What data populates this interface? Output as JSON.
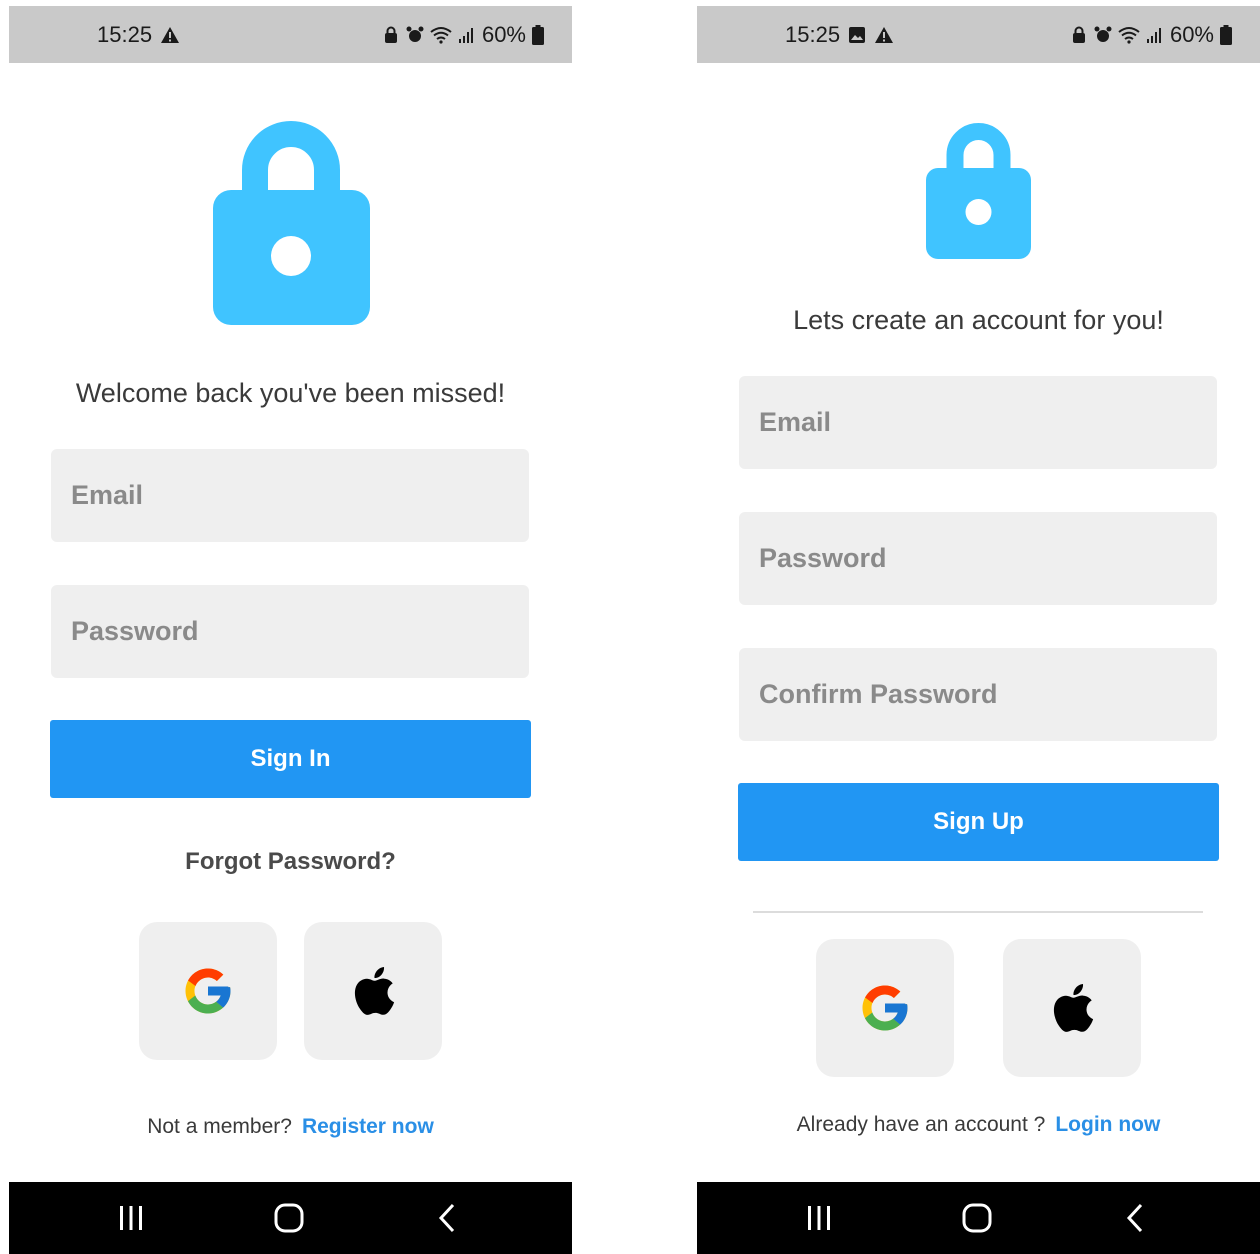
{
  "status_bar": {
    "time": "15:25",
    "battery": "60%"
  },
  "login_screen": {
    "welcome_text": "Welcome back you've been missed!",
    "email_placeholder": "Email",
    "password_placeholder": "Password",
    "sign_in_label": "Sign In",
    "forgot_password_label": "Forgot Password?",
    "footer_prompt": "Not a member?",
    "footer_link": "Register now"
  },
  "signup_screen": {
    "heading_text": "Lets create an account for you!",
    "email_placeholder": "Email",
    "password_placeholder": "Password",
    "confirm_password_placeholder": "Confirm Password",
    "sign_up_label": "Sign Up",
    "footer_prompt": "Already have an account ?",
    "footer_link": "Login now"
  },
  "icons": {
    "lock": "lock-icon",
    "google": "google-icon",
    "apple": "apple-icon",
    "recent_apps": "recent-apps-icon",
    "home": "home-icon",
    "back": "back-icon"
  },
  "colors": {
    "accent_blue": "#2196f3",
    "lock_blue": "#40c4ff",
    "link_blue": "#2a8fe6",
    "field_bg": "#efefef"
  }
}
